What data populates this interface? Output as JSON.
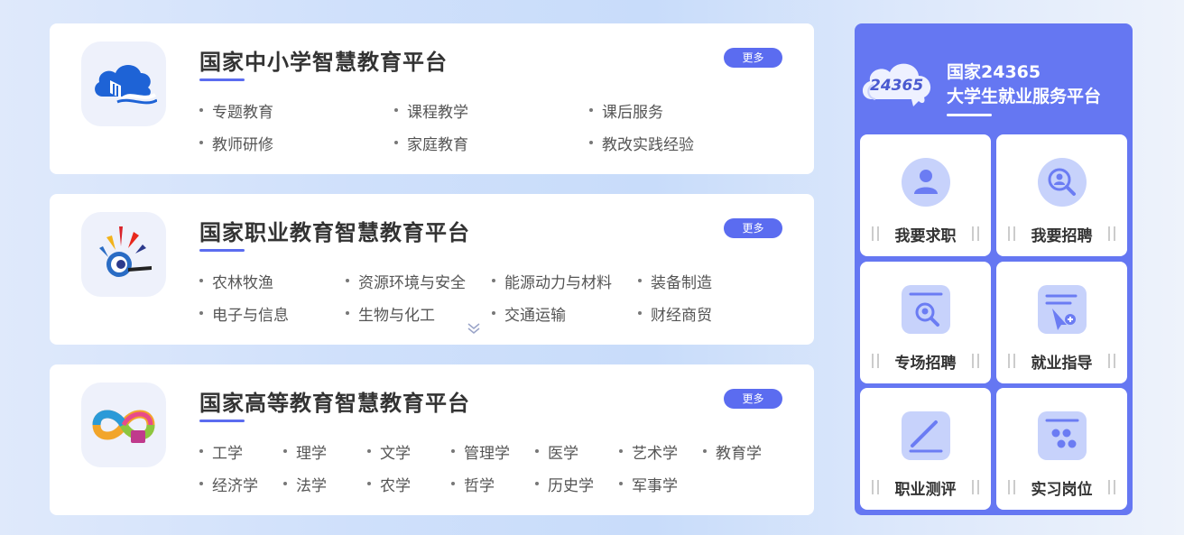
{
  "more_label": "更多",
  "platforms": [
    {
      "title": "国家中小学智慧教育平台",
      "rows": [
        [
          "专题教育",
          "课程教学",
          "课后服务"
        ],
        [
          "教师研修",
          "家庭教育",
          "教改实践经验"
        ]
      ]
    },
    {
      "title": "国家职业教育智慧教育平台",
      "rows": [
        [
          "农林牧渔",
          "资源环境与安全",
          "能源动力与材料",
          "装备制造"
        ],
        [
          "电子与信息",
          "生物与化工",
          "交通运输",
          "财经商贸"
        ]
      ]
    },
    {
      "title": "国家高等教育智慧教育平台",
      "rows": [
        [
          "工学",
          "理学",
          "文学",
          "管理学",
          "医学",
          "艺术学",
          "教育学"
        ],
        [
          "经济学",
          "法学",
          "农学",
          "哲学",
          "历史学",
          "军事学"
        ]
      ]
    }
  ],
  "employment": {
    "logo_text": "24365",
    "title_line1": "国家24365",
    "title_line2": "大学生就业服务平台",
    "tiles": [
      {
        "label": "我要求职",
        "icon": "job-seeker-icon"
      },
      {
        "label": "我要招聘",
        "icon": "recruit-search-icon"
      },
      {
        "label": "专场招聘",
        "icon": "special-recruitment-icon"
      },
      {
        "label": "就业指导",
        "icon": "employment-guidance-icon"
      },
      {
        "label": "职业测评",
        "icon": "career-assessment-icon"
      },
      {
        "label": "实习岗位",
        "icon": "internship-icon"
      }
    ]
  },
  "colors": {
    "accent": "#5b6cf0",
    "panel": "#6577f2",
    "icon_light": "#c7d2fb",
    "icon_dark": "#6b7cf3"
  }
}
